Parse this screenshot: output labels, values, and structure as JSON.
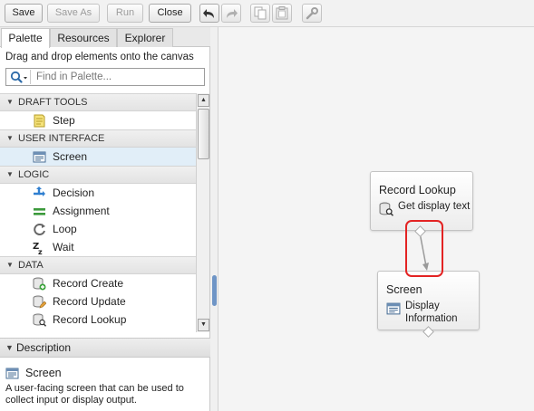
{
  "toolbar": {
    "save": "Save",
    "save_as": "Save As",
    "run": "Run",
    "close": "Close"
  },
  "tabs": [
    {
      "label": "Palette",
      "active": true
    },
    {
      "label": "Resources",
      "active": false
    },
    {
      "label": "Explorer",
      "active": false
    }
  ],
  "palette": {
    "hint": "Drag and drop elements onto the canvas",
    "search_placeholder": "Find in Palette...",
    "categories": [
      {
        "label": "DRAFT TOOLS",
        "items": [
          {
            "label": "Step",
            "icon": "step-icon"
          }
        ]
      },
      {
        "label": "USER INTERFACE",
        "items": [
          {
            "label": "Screen",
            "icon": "screen-icon",
            "selected": true
          }
        ]
      },
      {
        "label": "LOGIC",
        "items": [
          {
            "label": "Decision",
            "icon": "decision-icon"
          },
          {
            "label": "Assignment",
            "icon": "assignment-icon"
          },
          {
            "label": "Loop",
            "icon": "loop-icon"
          },
          {
            "label": "Wait",
            "icon": "wait-icon"
          }
        ]
      },
      {
        "label": "DATA",
        "items": [
          {
            "label": "Record Create",
            "icon": "record-create-icon"
          },
          {
            "label": "Record Update",
            "icon": "record-update-icon"
          },
          {
            "label": "Record Lookup",
            "icon": "record-lookup-icon"
          }
        ]
      }
    ]
  },
  "description": {
    "header": "Description",
    "title": "Screen",
    "text": "A user-facing screen that can be used to collect input or display output."
  },
  "canvas": {
    "nodes": [
      {
        "title": "Record Lookup",
        "subtitle": "Get display text",
        "icon": "record-lookup-icon"
      },
      {
        "title": "Screen",
        "subtitle_line1": "Display",
        "subtitle_line2": "Information",
        "icon": "screen-icon"
      }
    ]
  },
  "colors": {
    "selection": "#e1eef8",
    "highlight": "#e32323",
    "splitter_grip": "#6f95c6"
  }
}
